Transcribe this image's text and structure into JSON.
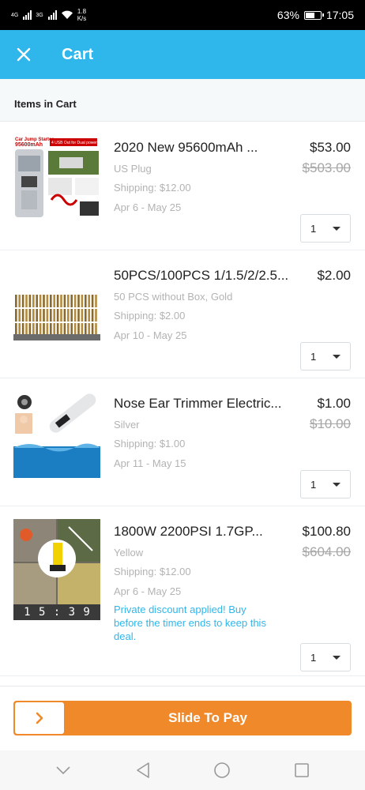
{
  "status_bar": {
    "net1": "4G",
    "net2": "3G",
    "speed_value": "1.8",
    "speed_unit": "K/s",
    "battery": "63%",
    "battery_level": 0.63,
    "time": "17:05"
  },
  "header": {
    "close_icon": "close-icon",
    "title": "Cart"
  },
  "section": {
    "label": "Items in Cart"
  },
  "items": [
    {
      "title": "2020 New 95600mAh ...",
      "price": "$53.00",
      "original_price": "$503.00",
      "variant": "US Plug",
      "shipping": "Shipping: $12.00",
      "delivery": "Apr 6 - May 25",
      "quantity": "1",
      "image": "car-jump-starter-image",
      "image_text_1": "Car Jump Starter",
      "image_text_2": "95600mAh",
      "image_text_3": "4 USB Out for Dual power"
    },
    {
      "title": "50PCS/100PCS 1/1.5/2/2.5...",
      "price": "$2.00",
      "variant": "50 PCS without Box, Gold",
      "shipping": "Shipping: $2.00",
      "delivery": "Apr 10 - May 25",
      "quantity": "1",
      "image": "drill-bits-image"
    },
    {
      "title": "Nose Ear Trimmer Electric...",
      "price": "$1.00",
      "original_price": "$10.00",
      "variant": "Silver",
      "shipping": "Shipping: $1.00",
      "delivery": "Apr 11 - May 15",
      "quantity": "1",
      "image": "nose-trimmer-image"
    },
    {
      "title": "1800W 2200PSI 1.7GP...",
      "price": "$100.80",
      "original_price": "$604.00",
      "variant": "Yellow",
      "shipping": "Shipping: $12.00",
      "delivery": "Apr 6 - May 25",
      "promo": "Private discount applied! Buy before the timer ends to keep this deal.",
      "timer": [
        "1",
        "5",
        ":",
        "3",
        "9"
      ],
      "quantity": "1",
      "image": "pressure-washer-image"
    }
  ],
  "checkout": {
    "slide_label": "Slide To Pay",
    "knob_icon": "chevron-right-icon",
    "accent_color": "#f0892a"
  },
  "nav_bar": {
    "buttons": [
      "hide-keyboard-icon",
      "back-icon",
      "home-icon",
      "recents-icon"
    ]
  },
  "colors": {
    "header_bg": "#2fb7ec",
    "promo_text": "#2fb7ec"
  }
}
